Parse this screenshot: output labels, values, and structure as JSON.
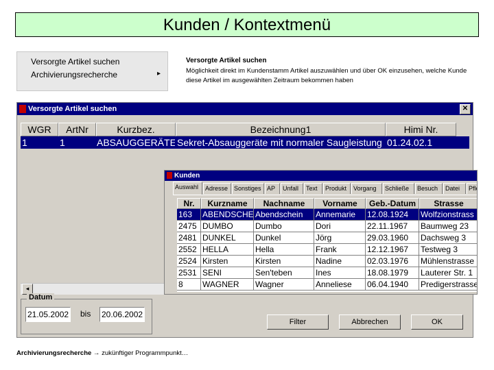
{
  "slide_title": "Kunden / Kontextmenü",
  "context_menu": {
    "items": [
      {
        "label": "Versorgte Artikel suchen"
      },
      {
        "label": "Archivierungsrecherche"
      }
    ],
    "submenu_arrow": "▸"
  },
  "description": {
    "title": "Versorgte Artikel suchen",
    "text": "Möglichkeit direkt im Kundenstamm Artikel auszuwählen und über OK einzusehen, welche Kunde diese Artikel im ausgewählten Zeitraum bekommen haben"
  },
  "main_window": {
    "title": "Versorgte Artikel suchen",
    "close_label": "✕",
    "columns": [
      "WGR",
      "ArtNr",
      "Kurzbez.",
      "Bezeichnung1",
      "Himi Nr."
    ],
    "row": {
      "wgr": "1",
      "artnr": "1",
      "kurzbez": "ABSAUGGERÄTE",
      "bezeichnung": "Sekret-Absauggeräte mit normaler Saugleistung",
      "himi": "01.24.02.1"
    },
    "date_group_label": "Datum",
    "date_from": "21.05.2002",
    "bis_label": "bis",
    "date_to": "20.06.2002",
    "buttons": {
      "filter": "Filter",
      "cancel": "Abbrechen",
      "ok": "OK"
    },
    "scroll_left_arrow": "◂"
  },
  "kunden_window": {
    "title": "Kunden",
    "tabs": [
      "Auswahl",
      "Adresse",
      "Sonstiges",
      "AP",
      "Unfall",
      "Text",
      "Produkt",
      "Vorgang",
      "Schließe",
      "Besuch",
      "Datei",
      "Pfle"
    ],
    "columns": [
      "Nr.",
      "Kurzname",
      "Nachname",
      "Vorname",
      "Geb.-Datum",
      "Strasse"
    ],
    "rows": [
      {
        "nr": "163",
        "kurzname": "ABENDSCHEIN",
        "nachname": "Abendschein",
        "vorname": "Annemarie",
        "geb": "12.08.1924",
        "strasse": "Wolfzionstrass"
      },
      {
        "nr": "2475",
        "kurzname": "DUMBO",
        "nachname": "Dumbo",
        "vorname": "Dori",
        "geb": "22.11.1967",
        "strasse": "Baumweg 23"
      },
      {
        "nr": "2481",
        "kurzname": "DUNKEL",
        "nachname": "Dunkel",
        "vorname": "Jörg",
        "geb": "29.03.1960",
        "strasse": "Dachsweg 3"
      },
      {
        "nr": "2552",
        "kurzname": "HELLA",
        "nachname": "Hella",
        "vorname": "Frank",
        "geb": "12.12.1967",
        "strasse": "Testweg 3"
      },
      {
        "nr": "2524",
        "kurzname": "Kirsten",
        "nachname": "Kirsten",
        "vorname": "Nadine",
        "geb": "02.03.1976",
        "strasse": "Mühlenstrasse"
      },
      {
        "nr": "2531",
        "kurzname": "SENI",
        "nachname": "Sen'teben",
        "vorname": "Ines",
        "geb": "18.08.1979",
        "strasse": "Lauterer Str. 1"
      },
      {
        "nr": "8",
        "kurzname": "WAGNER",
        "nachname": "Wagner",
        "vorname": "Anneliese",
        "geb": "06.04.1940",
        "strasse": "Predigerstrasse"
      }
    ]
  },
  "footer": {
    "bold": "Archivierungsrecherche",
    "rest": " → zukünftiger Programmpunkt…"
  }
}
